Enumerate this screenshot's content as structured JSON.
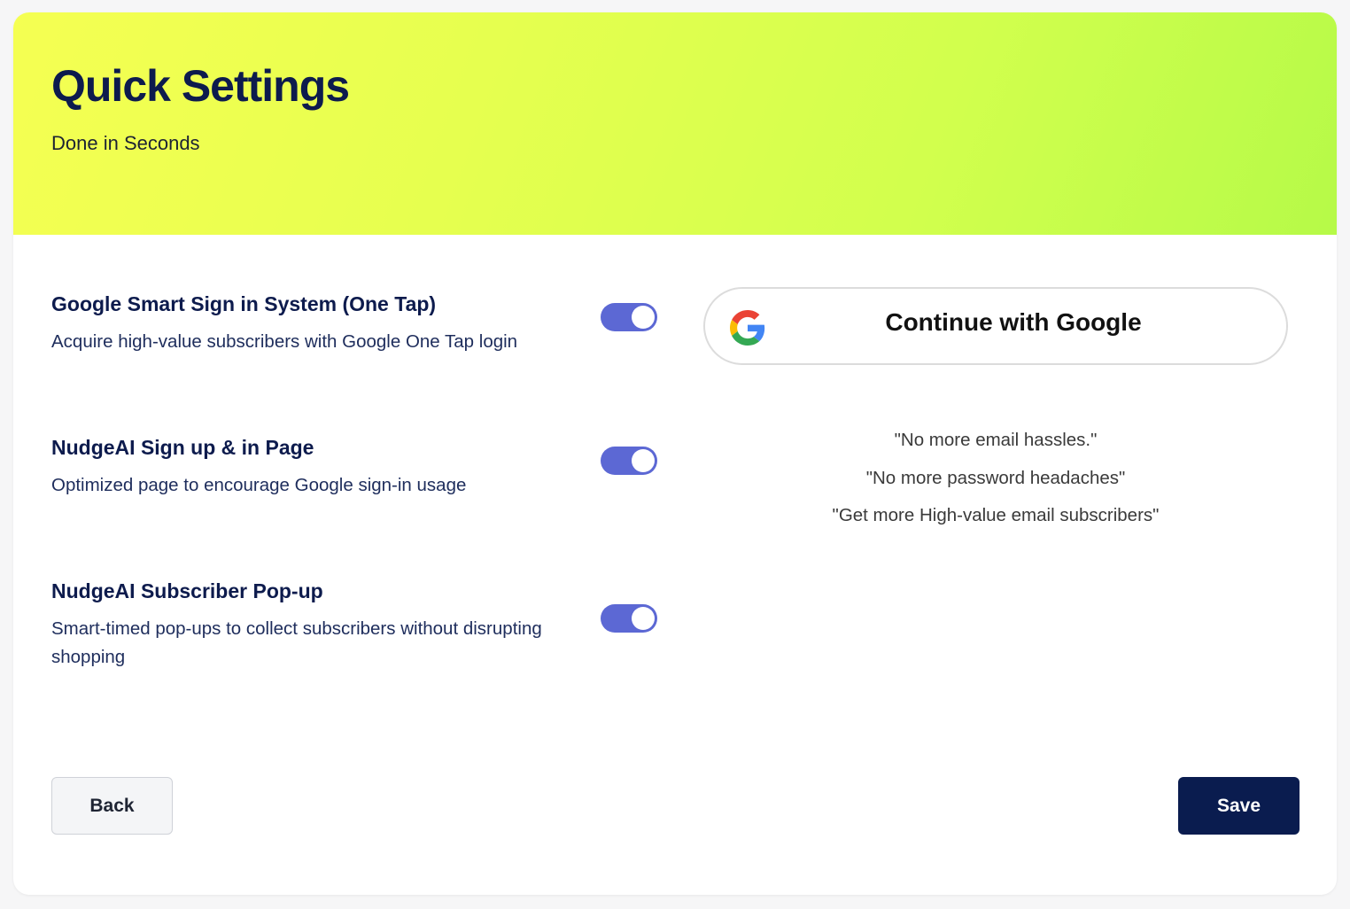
{
  "header": {
    "title": "Quick Settings",
    "subtitle": "Done in Seconds",
    "gradient_colors": [
      "#f5ff52",
      "#b6fa48"
    ]
  },
  "settings": [
    {
      "title": "Google Smart Sign in System (One Tap)",
      "description": "Acquire high-value subscribers with Google One Tap login",
      "enabled": true
    },
    {
      "title": "NudgeAI Sign up & in Page",
      "description": "Optimized page to encourage Google sign-in usage",
      "enabled": true
    },
    {
      "title": "NudgeAI Subscriber Pop-up",
      "description": "Smart-timed pop-ups to collect subscribers without disrupting shopping",
      "enabled": true
    }
  ],
  "preview": {
    "google_button_label": "Continue with Google",
    "google_icon": "google-g-icon",
    "quotes": [
      "\"No more email hassles.\"",
      "\"No more password headaches\"",
      "\"Get more High-value email subscribers\""
    ]
  },
  "footer": {
    "back_label": "Back",
    "save_label": "Save"
  },
  "colors": {
    "toggle_on": "#5c68d4",
    "primary": "#0a1c4f",
    "heading": "#0d1b4d"
  }
}
